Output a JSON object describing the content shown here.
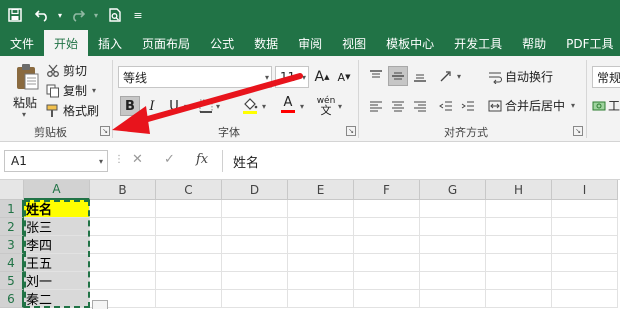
{
  "quick_access": {
    "save_icon": "save-icon",
    "undo_icon": "undo-icon",
    "redo_icon": "redo-icon",
    "preview_icon": "print-preview-icon",
    "customize_glyph": "≡"
  },
  "tabs": [
    {
      "label": "文件",
      "active": false
    },
    {
      "label": "开始",
      "active": true
    },
    {
      "label": "插入",
      "active": false
    },
    {
      "label": "页面布局",
      "active": false
    },
    {
      "label": "公式",
      "active": false
    },
    {
      "label": "数据",
      "active": false
    },
    {
      "label": "审阅",
      "active": false
    },
    {
      "label": "视图",
      "active": false
    },
    {
      "label": "模板中心",
      "active": false
    },
    {
      "label": "开发工具",
      "active": false
    },
    {
      "label": "帮助",
      "active": false
    },
    {
      "label": "PDF工具",
      "active": false
    }
  ],
  "ribbon": {
    "clipboard": {
      "paste": "粘贴",
      "cut": "剪切",
      "copy": "复制",
      "format_painter": "格式刷",
      "group_label": "剪贴板"
    },
    "font": {
      "font_name": "等线",
      "font_size": "11",
      "bold": "B",
      "italic": "I",
      "underline": "U",
      "grow": "A",
      "shrink": "A",
      "font_color": "A",
      "phonetic": "wén",
      "group_label": "字体"
    },
    "alignment": {
      "wrap_text": "自动换行",
      "merge_center": "合并后居中",
      "group_label": "对齐方式"
    },
    "number": {
      "format": "常规",
      "tools": "工具"
    },
    "colors": {
      "highlight": "#ffff00",
      "font_color": "#ff0000"
    }
  },
  "formula_bar": {
    "name_box": "A1",
    "cancel": "✕",
    "enter": "✓",
    "fx": "fx",
    "content": "姓名"
  },
  "sheet": {
    "columns": [
      "A",
      "B",
      "C",
      "D",
      "E",
      "F",
      "G",
      "H",
      "I"
    ],
    "rows": [
      "1",
      "2",
      "3",
      "4",
      "5",
      "6"
    ],
    "cells_A": [
      "姓名",
      "张三",
      "李四",
      "王五",
      "刘一",
      "秦二"
    ],
    "accent": "#217346",
    "selection_fill": "#d9d9d9",
    "header_fill": "#ffff00"
  },
  "annotation": {
    "arrow_color": "#e8141c"
  }
}
